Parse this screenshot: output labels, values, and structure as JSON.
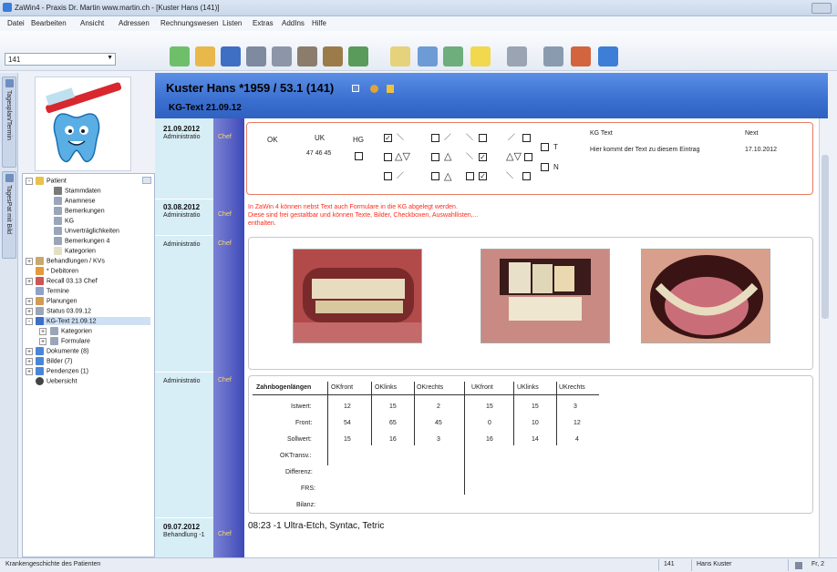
{
  "window": {
    "title": "ZaWin4 - Praxis Dr. Martin www.martin.ch - [Kuster Hans (141)]"
  },
  "menu": [
    "Datei",
    "Bearbeiten",
    "Ansicht",
    "Adressen",
    "Rechnungswesen",
    "Listen",
    "Extras",
    "AddIns",
    "Hilfe"
  ],
  "patient_combo": {
    "value": "141"
  },
  "left_tabs": [
    "Tagesplan/Termin",
    "TagesPat mit Bild"
  ],
  "header": {
    "patient": "Kuster Hans  *1959 / 53.1 (141)",
    "subtitle": "KG-Text 21.09.12"
  },
  "tree": [
    {
      "label": "Patient",
      "level": 0,
      "expander": "⊟",
      "color": "#e8c14e"
    },
    {
      "label": "Stammdaten",
      "level": 1,
      "color": "#7a7a7a"
    },
    {
      "label": "Anamnese",
      "level": 1,
      "color": "#9aa6b8"
    },
    {
      "label": "Bemerkungen",
      "level": 1,
      "color": "#9aa6b8"
    },
    {
      "label": "KG",
      "level": 1,
      "color": "#9aa6b8"
    },
    {
      "label": "Unverträglichkeiten",
      "level": 1,
      "color": "#9aa6b8"
    },
    {
      "label": "Bemerkungen 4",
      "level": 1,
      "color": "#9aa6b8"
    },
    {
      "label": "Kategorien",
      "level": 1,
      "color": "#e3dfc6"
    },
    {
      "label": "Behandlungen / KVs",
      "level": 0,
      "expander": "⊞",
      "color": "#c6a96e"
    },
    {
      "label": "* Debitoren",
      "level": 0,
      "color": "#e39a3b"
    },
    {
      "label": "Recall 03.13 Chef",
      "level": 0,
      "expander": "⊞",
      "color": "#cc5555"
    },
    {
      "label": "Termine",
      "level": 0,
      "color": "#8fa3c8"
    },
    {
      "label": "Planungen",
      "level": 0,
      "expander": "⊞",
      "color": "#d39a54"
    },
    {
      "label": "Status 03.09.12",
      "level": 0,
      "expander": "⊞",
      "color": "#9aa6b8"
    },
    {
      "label": "KG-Text 21.09.12",
      "level": 0,
      "expander": "⊟",
      "color": "#3d6fc8",
      "selected": true
    },
    {
      "label": "Kategorien",
      "level": 1,
      "expander": "⊞",
      "color": "#9aa6b8"
    },
    {
      "label": "Formulare",
      "level": 1,
      "expander": "⊞",
      "color": "#9aa6b8"
    },
    {
      "label": "Dokumente (8)",
      "level": 0,
      "expander": "⊞",
      "color": "#4a86d6"
    },
    {
      "label": "Bilder (7)",
      "level": 0,
      "expander": "⊞",
      "color": "#4a86d6"
    },
    {
      "label": "Pendenzen (1)",
      "level": 0,
      "expander": "⊞",
      "color": "#4a86d6"
    },
    {
      "label": "Uebersicht",
      "level": 0,
      "color": "#444444"
    }
  ],
  "entries": [
    {
      "date": "21.09.2012",
      "role": "Administratio",
      "by": "Chef"
    },
    {
      "date": "03.08.2012",
      "role": "Administratio",
      "by": "Chef"
    },
    {
      "date": "",
      "role": "Administratio",
      "by": "Chef"
    },
    {
      "date": "",
      "role": "Administratio",
      "by": "Chef"
    },
    {
      "date": "09.07.2012",
      "role": "Behandlung -1",
      "by": "Chef"
    }
  ],
  "form": {
    "ok": "OK",
    "uk": "UK",
    "hg": "HG",
    "uk_val": "47 46 45",
    "kg_text": "KG Text",
    "kg_note": "Hier kommt der Text zu diesem Eintrag",
    "next": "Next",
    "next_date": "17.10.2012",
    "t": "T",
    "n": "N"
  },
  "note2": {
    "line1": "In ZaWin 4 können nebst Text auch Formulare in die KG abgelegt werden.",
    "line2": "Diese sind frei gestaltbar und können Texte, Bilder, Checkboxen, Auswahllisten,...",
    "line3": "enthalten."
  },
  "table": {
    "title": "Zahnbogenlängen",
    "cols": [
      "OKfront",
      "OKlinks",
      "OKrechts",
      "UKfront",
      "UKlinks",
      "UKrechts"
    ],
    "rows": [
      {
        "label": "Istwert:",
        "vals": [
          "12",
          "15",
          "2",
          "15",
          "15",
          "3"
        ]
      },
      {
        "label": "Front:",
        "vals": [
          "54",
          "65",
          "45",
          "0",
          "10",
          "12"
        ]
      },
      {
        "label": "Sollwert:",
        "vals": [
          "15",
          "16",
          "3",
          "16",
          "14",
          "4"
        ]
      },
      {
        "label": "OKTransv.:",
        "vals": [
          "",
          "",
          "",
          "",
          "",
          ""
        ]
      },
      {
        "label": "Differenz:",
        "vals": [
          "",
          "",
          "",
          "",
          "",
          ""
        ]
      },
      {
        "label": "FRS:",
        "vals": [
          "",
          "",
          "",
          "",
          "",
          ""
        ]
      },
      {
        "label": "Bilanz:",
        "vals": [
          "",
          "",
          "",
          "",
          "",
          ""
        ]
      }
    ]
  },
  "last_entry": "08:23  -1 Ultra-Etch, Syntac, Tetric",
  "status": {
    "left": "Krankengeschichte des Patienten",
    "id": "141",
    "name": "Hans Kuster",
    "right": "Fr, 2"
  }
}
